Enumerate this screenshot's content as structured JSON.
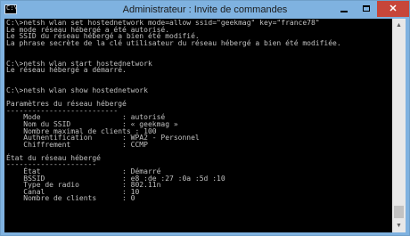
{
  "window": {
    "title": "Administrateur : Invite de commandes",
    "app_icon_glyph": "C:\\",
    "controls": {
      "minimize": "minimize-icon",
      "maximize": "maximize-icon",
      "close": "✕"
    }
  },
  "console": {
    "lines": [
      "C:\\>netsh wlan set hostednetwork mode=allow ssid=\"geekmag\" key=\"france78\"",
      "Le mode réseau hébergé a été autorisé.",
      "Le SSID du réseau hébergé a bien été modifié.",
      "La phrase secrète de la clé utilisateur du réseau hébergé a bien été modifiée.",
      "",
      "",
      "C:\\>netsh wlan start hostednetwork",
      "Le réseau hébergé a démarré.",
      "",
      "",
      "C:\\>netsh wlan show hostednetwork",
      "",
      "Paramètres du réseau hébergé",
      "--------------------------",
      "    Mode                   : autorisé",
      "    Nom du SSID            : « geekmag »",
      "    Nombre maximal de clients : 100",
      "    Authentification       : WPA2 - Personnel",
      "    Chiffrement            : CCMP",
      "",
      "État du réseau hébergé",
      "---------------------",
      "    État                   : Démarré",
      "    BSSID                  : e8 :de :27 :0a :5d :10",
      "    Type de radio          : 802.11n",
      "    Canal                  : 10",
      "    Nombre de clients      : 0",
      "",
      ""
    ]
  },
  "scrollbar": {
    "up": "▲",
    "down": "▼"
  },
  "colors": {
    "console_bg": "#000000",
    "console_text": "#c0c0c0",
    "titlebar": "#7fb2e0",
    "close": "#c7463a"
  }
}
